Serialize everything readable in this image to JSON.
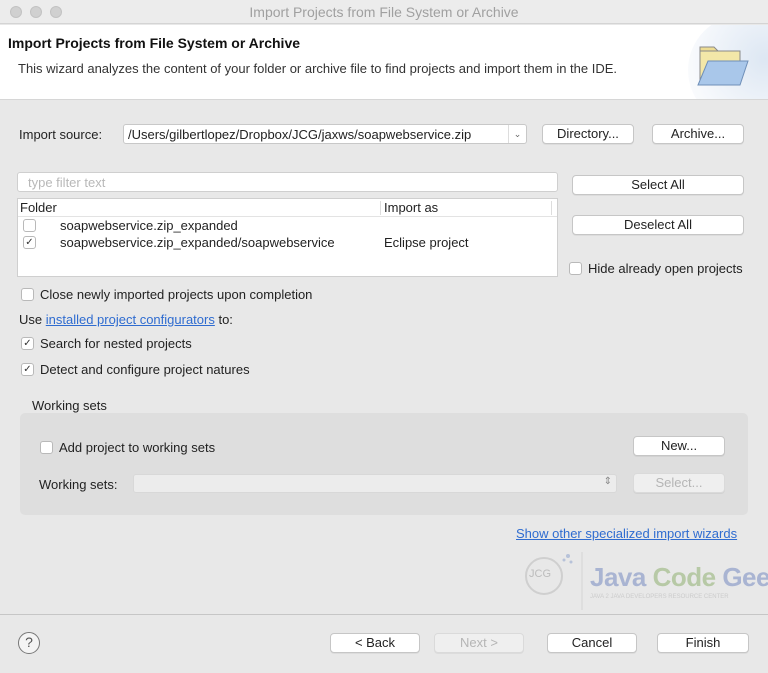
{
  "window": {
    "title": "Import Projects from File System or Archive"
  },
  "header": {
    "title": "Import Projects from File System or Archive",
    "description": "This wizard analyzes the content of your folder or archive file to find projects and import them in the IDE."
  },
  "import_source": {
    "label": "Import source:",
    "value": "/Users/gilbertlopez/Dropbox/JCG/jaxws/soapwebservice.zip",
    "directory_button": "Directory...",
    "archive_button": "Archive..."
  },
  "filter": {
    "placeholder": "type filter text",
    "value": ""
  },
  "table": {
    "columns": [
      "Folder",
      "Import as"
    ],
    "rows": [
      {
        "folder": "soapwebservice.zip_expanded",
        "import_as": "",
        "checked": false
      },
      {
        "folder": "soapwebservice.zip_expanded/soapwebservice",
        "import_as": "Eclipse project",
        "checked": true
      }
    ]
  },
  "side_buttons": {
    "select_all": "Select All",
    "deselect_all": "Deselect All",
    "hide_open": {
      "label": "Hide already open projects",
      "checked": false
    }
  },
  "options": {
    "close_newly": {
      "label": "Close newly imported projects upon completion",
      "checked": false
    },
    "use_prefix": "Use",
    "use_link": "installed project configurators",
    "use_suffix": "to:",
    "search_nested": {
      "label": "Search for nested projects",
      "checked": true
    },
    "detect_natures": {
      "label": "Detect and configure project natures",
      "checked": true
    }
  },
  "working_sets": {
    "group_label": "Working sets",
    "add_to": {
      "label": "Add project to working sets",
      "checked": false
    },
    "new_button": "New...",
    "combo_label": "Working sets:",
    "combo_value": "",
    "select_button": "Select..."
  },
  "specialized_link": "Show other specialized import wizards",
  "watermark": {
    "mark": "JCG",
    "title_a": "Java",
    "title_b": "Code",
    "title_c": "Geeks",
    "subtitle": "JAVA 2 JAVA DEVELOPERS RESOURCE CENTER"
  },
  "footer": {
    "help_icon": "?",
    "back": "< Back",
    "next": "Next >",
    "cancel": "Cancel",
    "finish": "Finish"
  },
  "check_glyph": "✓"
}
